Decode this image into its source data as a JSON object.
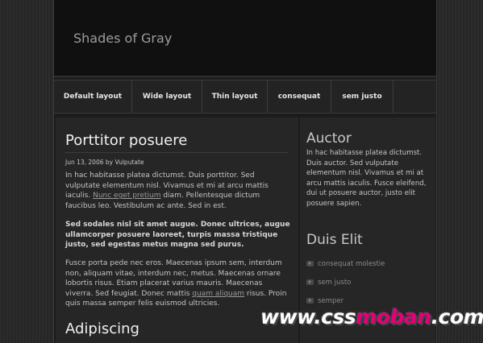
{
  "site": {
    "title": "Shades of Gray"
  },
  "nav": [
    {
      "label": "Default layout"
    },
    {
      "label": "Wide layout"
    },
    {
      "label": "Thin layout"
    },
    {
      "label": "consequat"
    },
    {
      "label": "sem justo"
    }
  ],
  "post": {
    "title": "Porttitor posuere",
    "meta": "Jun 13, 2006 by Vulputate",
    "p1_a": "In hac habitasse platea dictumst. Duis porttitor. Sed vulputate elementum nisl. Vivamus et mi at arcu mattis iaculis. ",
    "p1_link": "Nunc eget pretium",
    "p1_b": " diam. Pellentesque dictum faucibus leo. Vestibulum ac ante. Sed in est.",
    "p2": "Sed sodales nisl sit amet augue. Donec ultrices, augue ullamcorper posuere laoreet, turpis massa tristique justo, sed egestas metus magna sed purus.",
    "p3_a": "Fusce porta pede nec eros. Maecenas ipsum sem, interdum non, aliquam vitae, interdum nec, metus. Maecenas ornare lobortis risus. Etiam placerat varius mauris. Maecenas viverra. Sed feugiat. Donec mattis ",
    "p3_link": "quam aliquam",
    "p3_b": " risus. Proin quis massa semper felis euismod ultricies."
  },
  "post2": {
    "title": "Adipiscing"
  },
  "sidebar": {
    "auctor_title": "Auctor",
    "auctor_text": "In hac habitasse platea dictumst. Duis auctor. Sed vulputate elementum nisl. Vivamus et mi at arcu mattis iaculis. Fusce eleifend, dui ut posuere auctor, justo elit posuere sapien.",
    "duis_title": "Duis Elit",
    "items": [
      {
        "label": "consequat molestie"
      },
      {
        "label": "sem justo"
      },
      {
        "label": "semper"
      }
    ]
  },
  "watermark": {
    "part1": "www.css",
    "part2": "moban",
    "part3": ".com"
  }
}
